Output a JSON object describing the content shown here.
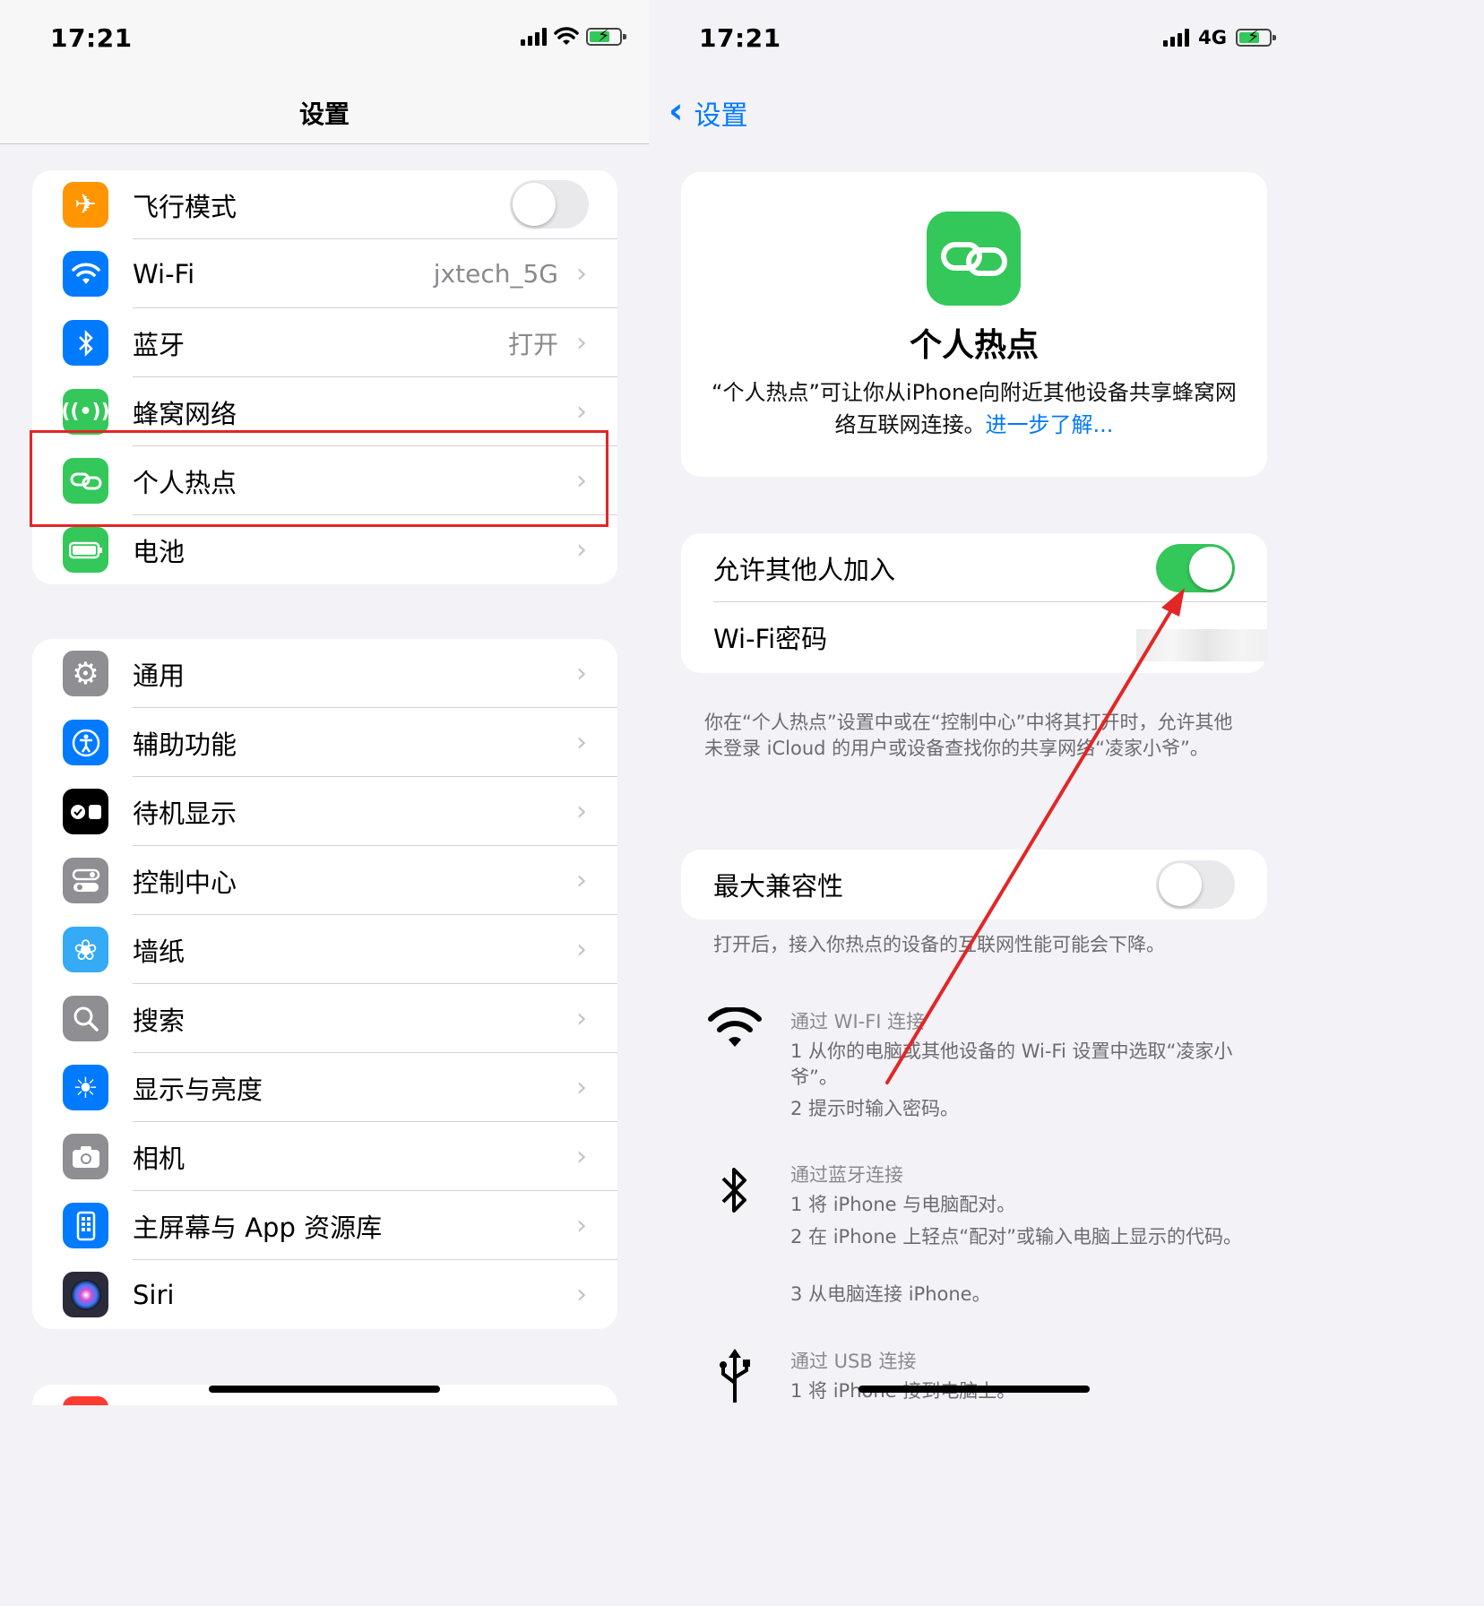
{
  "left": {
    "status": {
      "time": "17:21"
    },
    "nav": {
      "title": "设置"
    },
    "group1": [
      {
        "label": "飞行模式",
        "value": "",
        "icon": "airplane-icon",
        "color": "#ff9500",
        "toggle": "off"
      },
      {
        "label": "Wi-Fi",
        "value": "jxtech_5G",
        "icon": "wifi-icon",
        "color": "#007aff"
      },
      {
        "label": "蓝牙",
        "value": "打开",
        "icon": "bluetooth-icon",
        "color": "#007aff"
      },
      {
        "label": "蜂窝网络",
        "value": "",
        "icon": "cellular-icon",
        "color": "#34c759"
      },
      {
        "label": "个人热点",
        "value": "",
        "icon": "hotspot-icon",
        "color": "#34c759"
      },
      {
        "label": "电池",
        "value": "",
        "icon": "battery-icon",
        "color": "#34c759"
      }
    ],
    "group2": [
      {
        "label": "通用",
        "icon": "gear-icon",
        "color": "#8e8e93"
      },
      {
        "label": "辅助功能",
        "icon": "accessibility-icon",
        "color": "#007aff"
      },
      {
        "label": "待机显示",
        "icon": "standby-icon",
        "color": "#000000"
      },
      {
        "label": "控制中心",
        "icon": "control-center-icon",
        "color": "#8e8e93"
      },
      {
        "label": "墙纸",
        "icon": "wallpaper-icon",
        "color": "#35aaf5"
      },
      {
        "label": "搜索",
        "icon": "search-icon",
        "color": "#8e8e93"
      },
      {
        "label": "显示与亮度",
        "icon": "brightness-icon",
        "color": "#007aff"
      },
      {
        "label": "相机",
        "icon": "camera-icon",
        "color": "#8e8e93"
      },
      {
        "label": "主屏幕与 App 资源库",
        "icon": "home-screen-icon",
        "color": "#007aff"
      },
      {
        "label": "Siri",
        "icon": "siri-icon",
        "color": "#2b2b3a"
      }
    ]
  },
  "right": {
    "status": {
      "time": "17:21",
      "network": "4G"
    },
    "nav": {
      "back_label": "设置"
    },
    "intro": {
      "title": "个人热点",
      "desc": "“个人热点”可让你从iPhone向附近其他设备共享蜂窝网络互联网连接。",
      "link": "进一步了解..."
    },
    "allow": {
      "label": "允许其他人加入",
      "toggle": "on"
    },
    "wifi_password": {
      "label": "Wi-Fi密码"
    },
    "allow_note": "你在“个人热点”设置中或在“控制中心”中将其打开时，允许其他未登录 iCloud 的用户或设备查找你的共享网络“凌家小爷”。",
    "max_compat": {
      "label": "最大兼容性",
      "toggle": "off"
    },
    "max_compat_note": "打开后，接入你热点的设备的互联网性能可能会下降。",
    "wifi_conn": {
      "title": "通过 WI-FI 连接",
      "step1": "1 从你的电脑或其他设备的 Wi-Fi 设置中选取“凌家小爷”。",
      "step2": "2 提示时输入密码。"
    },
    "bt_conn": {
      "title": "通过蓝牙连接",
      "step1": "1 将 iPhone 与电脑配对。",
      "step2": "2 在 iPhone 上轻点“配对”或输入电脑上显示的代码。",
      "step3": "3 从电脑连接 iPhone。"
    },
    "usb_conn": {
      "title": "通过 USB 连接",
      "step1": "1 将 iPhone 接到电脑上。"
    }
  },
  "colors": {
    "accent": "#007aff",
    "green": "#34c759",
    "annotation": "#e32626"
  }
}
